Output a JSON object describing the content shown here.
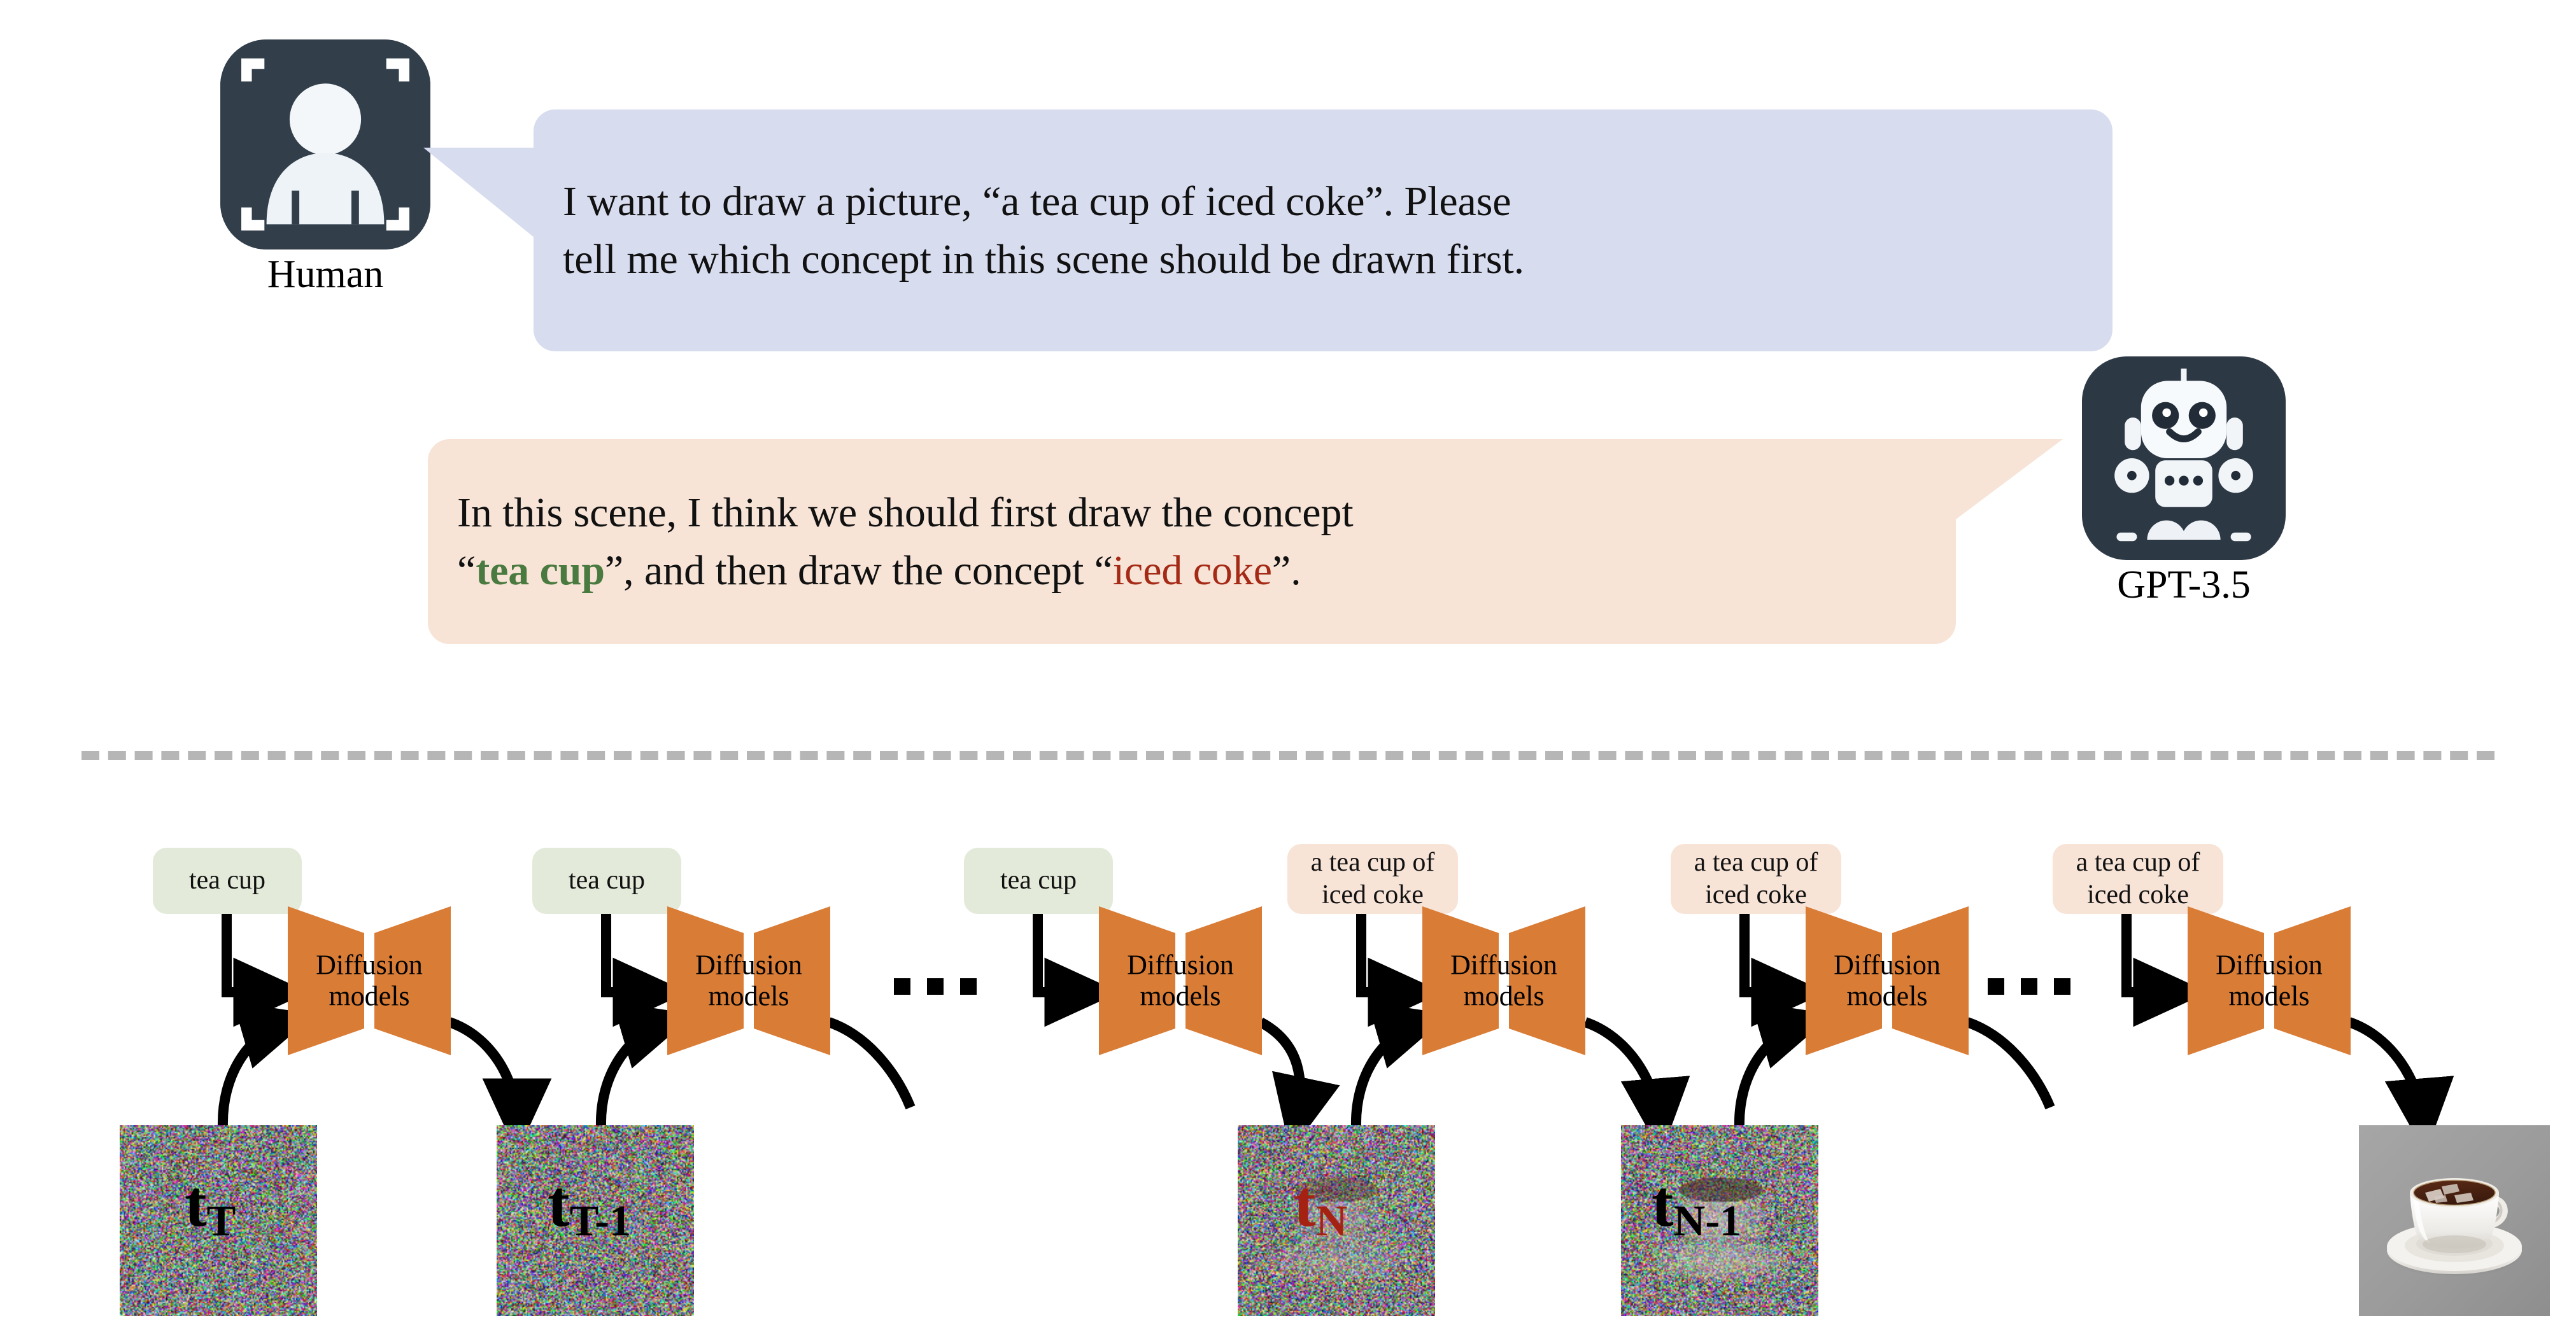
{
  "conversation": {
    "human": {
      "avatar_icon": "human-avatar-icon",
      "label": "Human",
      "message": "I want to draw a picture, “a tea cup of iced coke”. Please tell me which concept in this scene should be drawn first.",
      "message_line1": "I want to draw a picture, “a tea cup of iced coke”. Please",
      "message_line2": "tell me which concept in this scene should be drawn first.",
      "bubble_color": "#d7dcef"
    },
    "assistant": {
      "avatar_icon": "robot-avatar-icon",
      "label": "GPT-3.5",
      "message": "In this scene, I think we should first draw the concept “tea cup”, and then draw the concept “iced coke”.",
      "line1": "In this scene, I think we should first draw the concept",
      "line2_pre": "“",
      "line2_highlight1": "tea cup",
      "line2_mid": "”, and then draw the concept “",
      "line2_highlight2": "iced coke",
      "line2_post": "”.",
      "bubble_color": "#f7e4d7",
      "highlight1_color": "#4a7a3f",
      "highlight2_color": "#a52a16"
    }
  },
  "divider": {
    "style": "dashed",
    "color": "#b6b6b6"
  },
  "pipeline": {
    "model_label_line1": "Diffusion",
    "model_label_line2": "models",
    "model_color": "#d97c36",
    "prompt_early": "tea cup",
    "prompt_late_line1": "a tea cup of",
    "prompt_late_line2": "iced coke",
    "prompt_early_color": "#e3ead9",
    "prompt_late_color": "#f7e4d7",
    "ellipsis": "…",
    "steps": [
      {
        "id": "step-1",
        "prompt_kind": "early",
        "prompt_line1": "tea cup",
        "prompt_line2": "",
        "timestep_base": "t",
        "timestep_sub": "T",
        "timestep_color": "#000000"
      },
      {
        "id": "step-2",
        "prompt_kind": "early",
        "prompt_line1": "tea cup",
        "prompt_line2": "",
        "timestep_base": "t",
        "timestep_sub": "T-1",
        "timestep_color": "#000000"
      },
      {
        "id": "step-3",
        "prompt_kind": "early",
        "prompt_line1": "tea cup",
        "prompt_line2": "",
        "timestep_base": "",
        "timestep_sub": "",
        "timestep_color": "#000000"
      },
      {
        "id": "step-4",
        "prompt_kind": "late",
        "prompt_line1": "a tea cup of",
        "prompt_line2": "iced coke",
        "timestep_base": "t",
        "timestep_sub": "N",
        "timestep_color": "#a52213"
      },
      {
        "id": "step-5",
        "prompt_kind": "late",
        "prompt_line1": "a tea cup of",
        "prompt_line2": "iced coke",
        "timestep_base": "t",
        "timestep_sub": "N-1",
        "timestep_color": "#000000"
      },
      {
        "id": "step-6",
        "prompt_kind": "late",
        "prompt_line1": "a tea cup of",
        "prompt_line2": "iced coke",
        "timestep_base": "",
        "timestep_sub": "",
        "timestep_color": "#000000"
      }
    ],
    "final_image_alt": "a tea cup of iced coke"
  }
}
